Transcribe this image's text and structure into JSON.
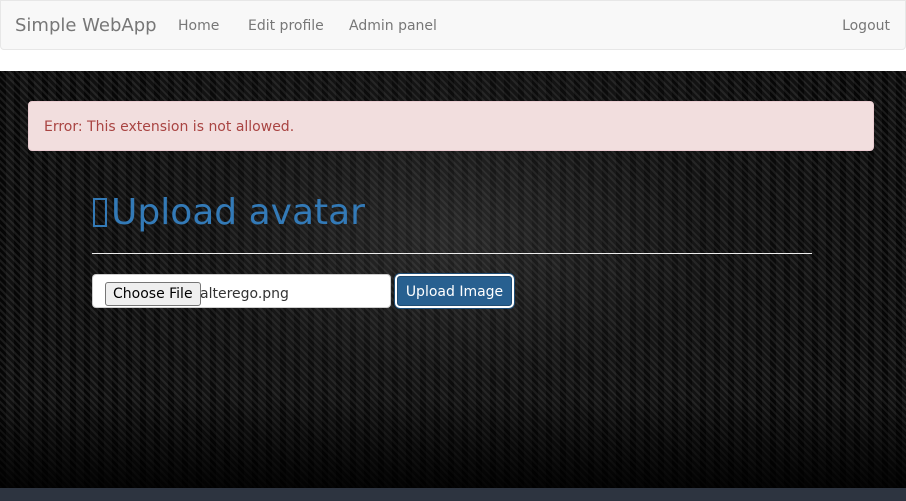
{
  "navbar": {
    "brand": "Simple WebApp",
    "links": [
      "Home",
      "Edit profile",
      "Admin panel"
    ],
    "logout": "Logout"
  },
  "alert": {
    "message": "Error: This extension is not allowed."
  },
  "main": {
    "title": "Upload avatar",
    "title_icon": "unrendered-glyph-box-icon",
    "file_input": {
      "button_label": "Choose File",
      "selected_file": "alterego.png"
    },
    "submit_label": "Upload Image"
  },
  "colors": {
    "alert_bg": "#f2dede",
    "alert_text": "#a94442",
    "title": "#337ab7",
    "primary_button": "#286090",
    "navbar_bg": "#f8f8f8"
  }
}
